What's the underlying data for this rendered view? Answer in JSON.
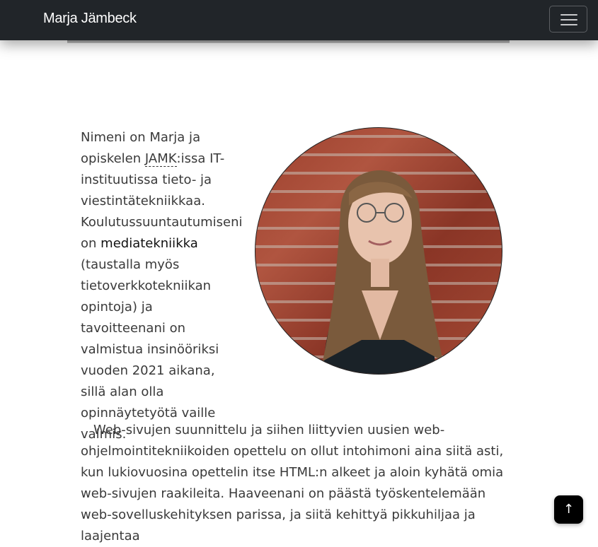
{
  "navbar": {
    "brand": "Marja Jämbeck",
    "menu_icon": "hamburger-menu-icon"
  },
  "intro": {
    "text_1": "Nimeni on Marja ja opiskelen ",
    "abbr": "JAMK",
    "text_2": ":issa IT-instituutissa tieto- ja viestintätekniikkaa. Koulutussuuntautumiseni on ",
    "strong": "mediatekniikka",
    "text_3": " (taustalla myös tietoverkkotekniikan opintoja) ja tavoitteenani on valmistua insinööriksi vuoden 2021 aikana, sillä alan olla opinnäytetyötä vaille valmis."
  },
  "photo": {
    "icon": "portrait-photo"
  },
  "body": {
    "paragraph": "Web-sivujen suunnittelu ja siihen liittyvien uusien web-ohjelmointitekniikoiden opettelu on ollut intohimoni aina siitä asti, kun lukiovuosina opettelin itse HTML:n alkeet ja aloin kyhätä omia web-sivujen raakileita. Haaveenani on päästä työskentelemään web-sovelluskehityksen parissa, ja siitä kehittyä pikkuhiljaa ja laajentaa"
  },
  "back_to_top": {
    "label": "↑",
    "icon": "arrow-up-icon"
  },
  "colors": {
    "navbar": "#212529",
    "text": "#3a3a3a"
  }
}
